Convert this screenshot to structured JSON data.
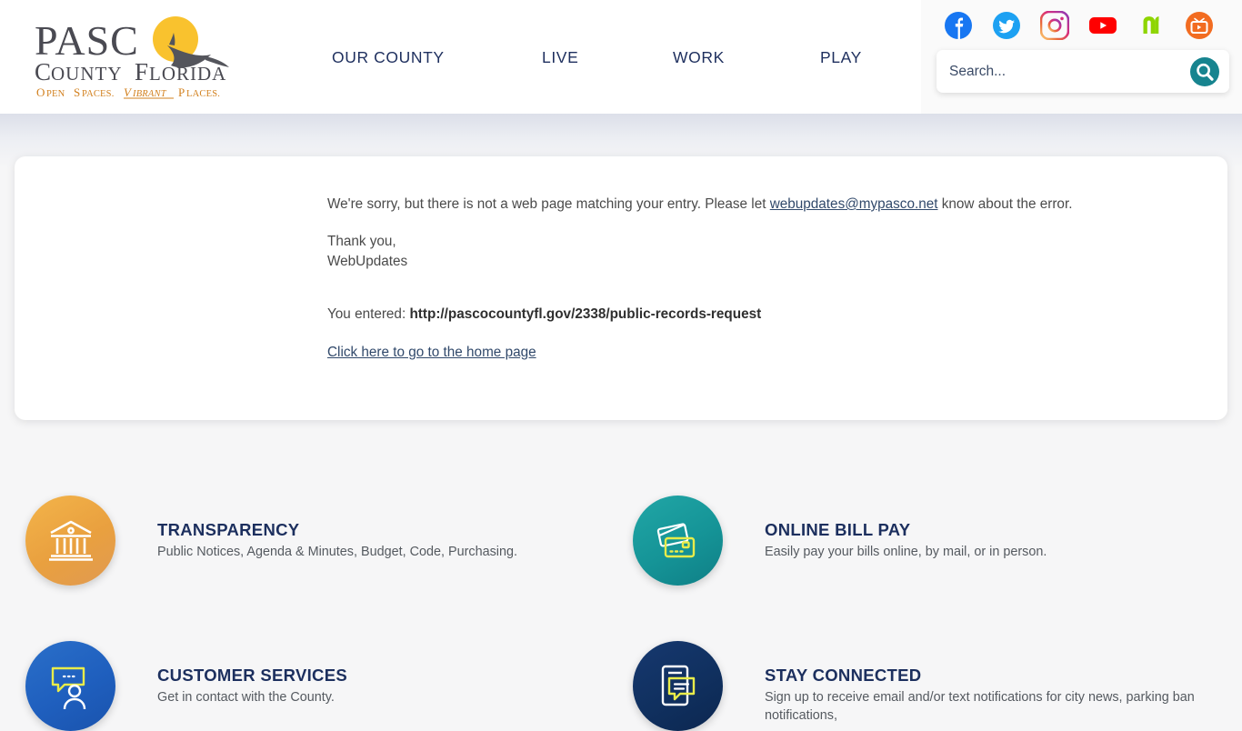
{
  "header": {
    "logo": {
      "line1": "PASCO",
      "line2_a": "COUNTY",
      "line2_b": "FLORIDA",
      "tagline_a": "OPEN SPACES.",
      "tagline_b": "VIBRANT",
      "tagline_c": "PLACES."
    },
    "nav": [
      {
        "label": "OUR COUNTY",
        "name": "nav-item-our-county"
      },
      {
        "label": "LIVE",
        "name": "nav-item-live"
      },
      {
        "label": "WORK",
        "name": "nav-item-work"
      },
      {
        "label": "PLAY",
        "name": "nav-item-play"
      }
    ],
    "socials": [
      {
        "icon": "facebook-icon",
        "color": "#1877f2"
      },
      {
        "icon": "twitter-icon",
        "color": "#1da1f2"
      },
      {
        "icon": "instagram-icon",
        "color": "#e1306c"
      },
      {
        "icon": "youtube-icon",
        "color": "#ff0000"
      },
      {
        "icon": "nextdoor-icon",
        "color": "#8ed500"
      },
      {
        "icon": "pasco-tv-icon",
        "color": "#f26c21"
      }
    ],
    "search": {
      "placeholder": "Search...",
      "value": "",
      "button_icon": "search-icon",
      "button_color": "#17848f"
    }
  },
  "main": {
    "error_text_before": "We're sorry, but there is not a web page matching your entry. Please let ",
    "error_email": "webupdates@mypasco.net",
    "error_text_after": " know about the error.",
    "thanks_line1": "Thank you,",
    "thanks_line2": "WebUpdates",
    "entered_label": "You entered: ",
    "entered_url": "http://pascocountyfl.gov/2338/public-records-request",
    "home_link": "Click here to go to the home page"
  },
  "quick_links": [
    {
      "title": "TRANSPARENCY",
      "desc": "Public Notices, Agenda & Minutes, Budget, Code, Purchasing.",
      "icon": "courthouse-icon",
      "color": "#e9a03f"
    },
    {
      "title": "ONLINE BILL PAY",
      "desc": "Easily pay your bills online, by mail, or in person.",
      "icon": "credit-cards-icon",
      "color": "#159497"
    },
    {
      "title": "CUSTOMER SERVICES",
      "desc": "Get in contact with the County.",
      "icon": "chat-person-icon",
      "color": "#1f5fbe"
    },
    {
      "title": "STAY CONNECTED",
      "desc": "Sign up to receive email and/or text notifications for city news, parking ban notifications,",
      "icon": "notification-device-icon",
      "color": "#10305f"
    }
  ]
}
